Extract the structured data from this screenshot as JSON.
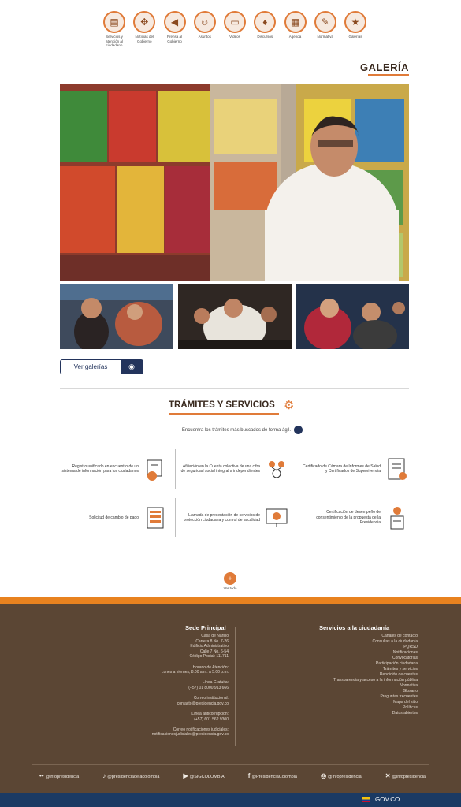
{
  "top_icons": [
    {
      "icon": "document-icon",
      "label": "Servicios y atención al ciudadano"
    },
    {
      "icon": "handshake-icon",
      "label": "Notícias del Gobierno"
    },
    {
      "icon": "megaphone-icon",
      "label": "Prensa al Gobierno"
    },
    {
      "icon": "people-icon",
      "label": "Asuntos"
    },
    {
      "icon": "monitor-icon",
      "label": "Videos"
    },
    {
      "icon": "mic-icon",
      "label": "Discursos"
    },
    {
      "icon": "calendar-icon",
      "label": "Agenda"
    },
    {
      "icon": "lightbulb-icon",
      "label": "Normativa"
    },
    {
      "icon": "star-icon",
      "label": "Galerías"
    }
  ],
  "gallery": {
    "title": "GALERÍA",
    "view_button": "Ver galerías"
  },
  "tramites": {
    "title": "TRÁMITES Y SERVICIOS",
    "subtitle": "Encuentra los trámites más buscados de forma ágil.",
    "cards": [
      {
        "icon": "certificate-icon",
        "text": "Certificado de Cámara de Informes de Salud y Certificados de Supervivencia"
      },
      {
        "icon": "people-network-icon",
        "text": "Afiliación en la Cuenta colectiva de una cifra de seguridad social integral a independientes"
      },
      {
        "icon": "folder-gear-icon",
        "text": "Registro unificado en encuentro de un sistema de información para los ciudadanos"
      },
      {
        "icon": "person-tool-icon",
        "text": "Certificación de desempeño de consentimiento de la propuesta de la Presidencia"
      },
      {
        "icon": "presentation-icon",
        "text": "Llamada de presentación de servicios de protección ciudadana y control de la calidad"
      },
      {
        "icon": "document-list-icon",
        "text": "Solicitud de cambio de pago"
      }
    ],
    "see_all": "Ver todo"
  },
  "footer": {
    "left_title": "Servicios a la ciudadanía",
    "left_items": [
      "Canales de contacto",
      "Consultas a la ciudadanía",
      "PQRSD",
      "Notificaciones",
      "Convocatorias",
      "Participación ciudadana",
      "Trámites y servicios",
      "Rendición de cuentas",
      "Transparencia y acceso a la información pública",
      "Normativa",
      "Glosario",
      "Preguntas frecuentes",
      "Mapa del sitio",
      "Políticas",
      "Datos abiertos"
    ],
    "right_title": "Sede Principal",
    "right_items": [
      "Casa de Nariño",
      "Carrera 8 No. 7-26",
      "",
      "Edificio Administrativo",
      "Calle 7 No. 6-54",
      "",
      "Código Postal: 111711",
      "Horario de Atención:",
      "Lunes a viernes, 8:00 a.m. a 5:00 p.m.",
      "",
      "Línea Gratuita:",
      "(+57) 01 8000 913 666",
      "",
      "Correo institucional:",
      "contacto@presidencia.gov.co",
      "",
      "Línea anticorrupción:",
      "(+57) 601 562 9300",
      "",
      "Correo notificaciones judiciales:",
      "notificacionesjudiciales@presidencia.gov.co"
    ],
    "social": [
      {
        "icon": "x-icon",
        "label": "@infopresidencia"
      },
      {
        "icon": "instagram-icon",
        "label": "@infopresidencia"
      },
      {
        "icon": "facebook-icon",
        "label": "@PresidenciaColombia"
      },
      {
        "icon": "youtube-icon",
        "label": "@SIGCOLOMBIA"
      },
      {
        "icon": "tiktok-icon",
        "label": "@presidenciadelacolombia"
      },
      {
        "icon": "flickr-icon",
        "label": "@infopresidencia"
      }
    ],
    "gov_label": "GOV.CO"
  },
  "colors": {
    "accent": "#e07b39",
    "navy": "#23345c",
    "footer_bg": "#5b4634",
    "footer_bar": "#e8821f",
    "bottom_bar": "#1b3a63"
  }
}
